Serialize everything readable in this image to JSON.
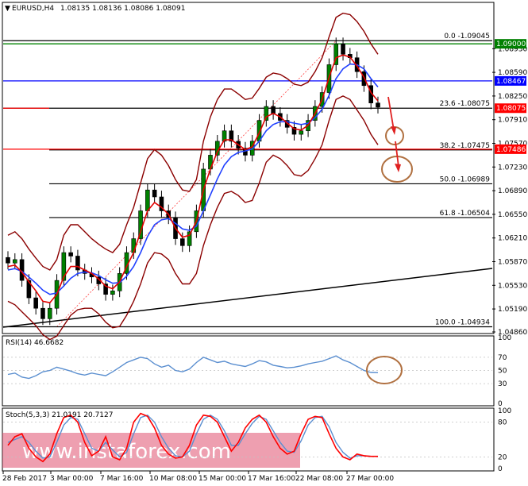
{
  "main": {
    "symbol_label": "EURUSD,H4",
    "ohlc": "1.08135 1.08136 1.08086 1.08091",
    "collapse_icon": "triangle-down-icon"
  },
  "colors": {
    "bull": "#008000",
    "bear": "#000000",
    "ma_fast": "#e00000",
    "ma_slow": "#2040ff",
    "bollinger": "#8b0000",
    "fib": "#000000",
    "trendline": "#000000",
    "ellipse": "#b07040",
    "arrow": "#e02020",
    "tag_green": "#008000",
    "tag_blue": "#0000ff",
    "tag_red": "#ff0000",
    "rsi": "#5b8fd0",
    "stoch_main": "#ff0000",
    "stoch_signal": "#5b8fd0",
    "watermark_bg": "#e05070"
  },
  "chart_data": [
    {
      "type": "candlestick",
      "title": "EURUSD,H4",
      "ylim": [
        1.0486,
        1.0939
      ],
      "y_ticks": [
        "1.08930",
        "1.08590",
        "1.08250",
        "1.07910",
        "1.07570",
        "1.07230",
        "1.06890",
        "1.06550",
        "1.06210",
        "1.05870",
        "1.05530",
        "1.05190",
        "1.04860"
      ],
      "price_tags": [
        {
          "label": "1.09000",
          "value": 1.09,
          "color": "green"
        },
        {
          "label": "1.08467",
          "value": 1.08467,
          "color": "blue"
        },
        {
          "label": "1.08075",
          "value": 1.08075,
          "color": "red"
        },
        {
          "label": "1.07486",
          "value": 1.07486,
          "color": "red"
        }
      ],
      "fibonacci": [
        {
          "label": "0.0 -1.09045",
          "value": 1.09045
        },
        {
          "label": "23.6 -1.08075",
          "value": 1.08075
        },
        {
          "label": "38.2 -1.07475",
          "value": 1.07475
        },
        {
          "label": "50.0 -1.06989",
          "value": 1.06989
        },
        {
          "label": "61.8 -1.06504",
          "value": 1.06504
        },
        {
          "label": "100.0 -1.04934",
          "value": 1.04934
        }
      ],
      "x_labels": [
        "28 Feb 2017",
        "3 Mar 00:00",
        "7 Mar 16:00",
        "10 Mar 08:00",
        "15 Mar 00:00",
        "17 Mar 16:00",
        "22 Mar 08:00",
        "27 Mar 00:00"
      ],
      "close_path": [
        1.0585,
        1.059,
        1.056,
        1.0535,
        1.052,
        1.0505,
        1.052,
        1.056,
        1.06,
        1.0595,
        1.0575,
        1.057,
        1.0565,
        1.0555,
        1.054,
        1.0545,
        1.057,
        1.06,
        1.062,
        1.066,
        1.069,
        1.068,
        1.066,
        1.065,
        1.062,
        1.061,
        1.063,
        1.066,
        1.072,
        1.074,
        1.076,
        1.0775,
        1.076,
        1.075,
        1.074,
        1.076,
        1.079,
        1.081,
        1.08,
        1.079,
        1.078,
        1.077,
        1.0775,
        1.079,
        1.081,
        1.083,
        1.087,
        1.09,
        1.0885,
        1.088,
        1.086,
        1.084,
        1.0815,
        1.0809
      ],
      "ma_fast": [
        1.058,
        1.0582,
        1.0572,
        1.0558,
        1.0545,
        1.053,
        1.0528,
        1.054,
        1.0565,
        1.058,
        1.058,
        1.0575,
        1.057,
        1.0562,
        1.0552,
        1.0548,
        1.0558,
        1.058,
        1.06,
        1.063,
        1.066,
        1.0672,
        1.0665,
        1.0655,
        1.0635,
        1.0622,
        1.0625,
        1.0645,
        1.069,
        1.072,
        1.0745,
        1.0762,
        1.0762,
        1.0755,
        1.0748,
        1.0752,
        1.0772,
        1.0795,
        1.08,
        1.0795,
        1.0786,
        1.0778,
        1.0776,
        1.0783,
        1.08,
        1.082,
        1.0852,
        1.088,
        1.0884,
        1.0881,
        1.0868,
        1.0852,
        1.083,
        1.0818
      ],
      "ma_slow": [
        1.0575,
        1.0577,
        1.0573,
        1.0565,
        1.0556,
        1.0546,
        1.054,
        1.0542,
        1.0552,
        1.0563,
        1.057,
        1.0572,
        1.0571,
        1.0567,
        1.0561,
        1.0556,
        1.0557,
        1.0566,
        1.058,
        1.06,
        1.0623,
        1.064,
        1.0647,
        1.0649,
        1.0642,
        1.0634,
        1.0632,
        1.0638,
        1.066,
        1.0683,
        1.0706,
        1.0726,
        1.0738,
        1.0744,
        1.0746,
        1.0749,
        1.076,
        1.0775,
        1.0784,
        1.0788,
        1.0788,
        1.0786,
        1.0784,
        1.0786,
        1.0794,
        1.0806,
        1.0826,
        1.085,
        1.0864,
        1.0871,
        1.087,
        1.0864,
        1.085,
        1.0838
      ],
      "bb_upper": [
        1.0625,
        1.063,
        1.062,
        1.0605,
        1.0592,
        1.058,
        1.0575,
        1.059,
        1.0625,
        1.064,
        1.064,
        1.063,
        1.062,
        1.0612,
        1.0605,
        1.06,
        1.0612,
        1.064,
        1.0665,
        1.07,
        1.0735,
        1.0748,
        1.074,
        1.0725,
        1.0705,
        1.069,
        1.0688,
        1.0705,
        1.076,
        1.0795,
        1.082,
        1.0835,
        1.0835,
        1.0828,
        1.082,
        1.0822,
        1.0836,
        1.0852,
        1.0858,
        1.0856,
        1.085,
        1.0842,
        1.084,
        1.0845,
        1.086,
        1.088,
        1.091,
        1.0938,
        1.0944,
        1.0942,
        1.0932,
        1.0918,
        1.09,
        1.0885
      ],
      "bb_lower": [
        1.053,
        1.0525,
        1.0515,
        1.0505,
        1.0495,
        1.0482,
        1.0475,
        1.048,
        1.0495,
        1.051,
        1.0518,
        1.052,
        1.052,
        1.0512,
        1.05,
        1.0492,
        1.0494,
        1.051,
        1.053,
        1.0555,
        1.0585,
        1.06,
        1.0598,
        1.059,
        1.057,
        1.0555,
        1.0555,
        1.057,
        1.061,
        1.064,
        1.0665,
        1.0685,
        1.0688,
        1.0682,
        1.0672,
        1.0675,
        1.07,
        1.073,
        1.074,
        1.0735,
        1.0725,
        1.0712,
        1.071,
        1.0718,
        1.0735,
        1.0755,
        1.079,
        1.082,
        1.0825,
        1.082,
        1.0805,
        1.079,
        1.077,
        1.0755
      ]
    },
    {
      "type": "line",
      "title": "RSI(14) 46.6682",
      "ylim": [
        0,
        100
      ],
      "y_ticks": [
        "100",
        "70",
        "50",
        "30",
        "0"
      ],
      "series": [
        {
          "name": "RSI(14)",
          "values": [
            44,
            46,
            40,
            38,
            42,
            48,
            50,
            55,
            52,
            49,
            45,
            43,
            46,
            44,
            42,
            48,
            55,
            62,
            66,
            70,
            68,
            60,
            55,
            58,
            50,
            48,
            52,
            62,
            70,
            66,
            62,
            64,
            60,
            58,
            56,
            60,
            65,
            63,
            58,
            56,
            54,
            55,
            57,
            60,
            62,
            64,
            68,
            72,
            66,
            62,
            56,
            50,
            47,
            46.6682
          ]
        }
      ]
    },
    {
      "type": "line",
      "title": "Stoch(5,3,3) 21.0191 20.7127",
      "ylim": [
        0,
        100
      ],
      "y_ticks": [
        "100",
        "80",
        "20",
        "0"
      ],
      "series": [
        {
          "name": "Stoch main",
          "values": [
            40,
            55,
            60,
            35,
            20,
            12,
            25,
            60,
            88,
            92,
            80,
            45,
            22,
            30,
            55,
            20,
            15,
            35,
            80,
            95,
            90,
            70,
            40,
            25,
            18,
            20,
            40,
            75,
            92,
            90,
            80,
            55,
            30,
            45,
            70,
            85,
            92,
            80,
            55,
            35,
            25,
            30,
            60,
            85,
            90,
            88,
            60,
            35,
            20,
            15,
            25,
            22,
            21,
            21.0191
          ]
        },
        {
          "name": "Stoch signal",
          "values": [
            45,
            50,
            55,
            45,
            30,
            18,
            20,
            45,
            75,
            88,
            85,
            60,
            35,
            30,
            45,
            32,
            20,
            28,
            60,
            88,
            92,
            80,
            55,
            35,
            22,
            20,
            30,
            60,
            85,
            92,
            85,
            65,
            40,
            40,
            60,
            78,
            90,
            85,
            65,
            45,
            30,
            28,
            48,
            75,
            88,
            90,
            72,
            45,
            28,
            18,
            22,
            22,
            21,
            20.7127
          ]
        }
      ]
    }
  ],
  "watermark": "www.instaforex.com"
}
